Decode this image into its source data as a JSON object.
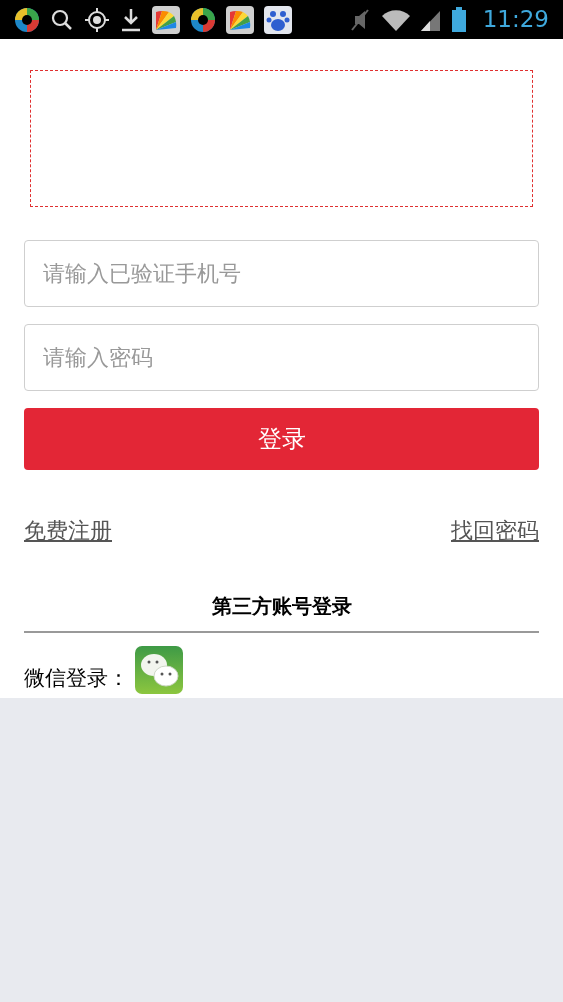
{
  "status_bar": {
    "time": "11:29"
  },
  "form": {
    "phone": {
      "placeholder": "请输入已验证手机号"
    },
    "password": {
      "placeholder": "请输入密码"
    },
    "submit": "登录"
  },
  "links": {
    "register": "免费注册",
    "recover": "找回密码"
  },
  "third_party": {
    "title": "第三方账号登录",
    "wechat_label": "微信登录："
  }
}
